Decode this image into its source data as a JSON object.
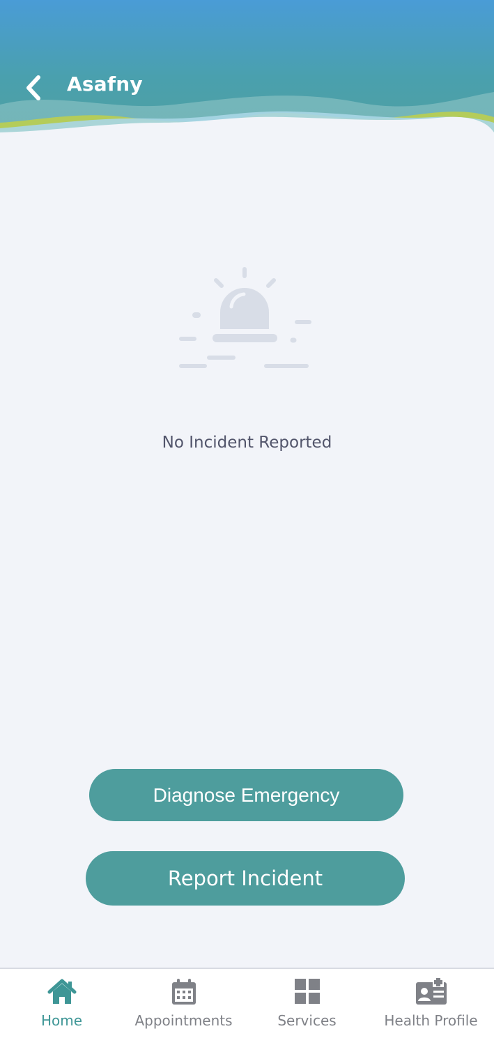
{
  "header": {
    "title": "Asafny",
    "back_icon": "chevron-left-icon"
  },
  "empty_state": {
    "icon": "siren-alarm-icon",
    "message": "No Incident Reported"
  },
  "actions": {
    "diagnose_label": "Diagnose Emergency",
    "report_label": "Report Incident"
  },
  "bottom_nav": {
    "items": [
      {
        "label": "Home",
        "icon": "home-icon",
        "active": true
      },
      {
        "label": "Appointments",
        "icon": "calendar-icon",
        "active": false
      },
      {
        "label": "Services",
        "icon": "grid-icon",
        "active": false
      },
      {
        "label": "Health Profile",
        "icon": "id-card-icon",
        "active": false
      }
    ]
  },
  "colors": {
    "primary": "#4e9d9d",
    "active_nav": "#3e9696",
    "background": "#f2f4f9",
    "header_top": "#4a9cd6",
    "header_accent_green": "#b4cc5a"
  }
}
